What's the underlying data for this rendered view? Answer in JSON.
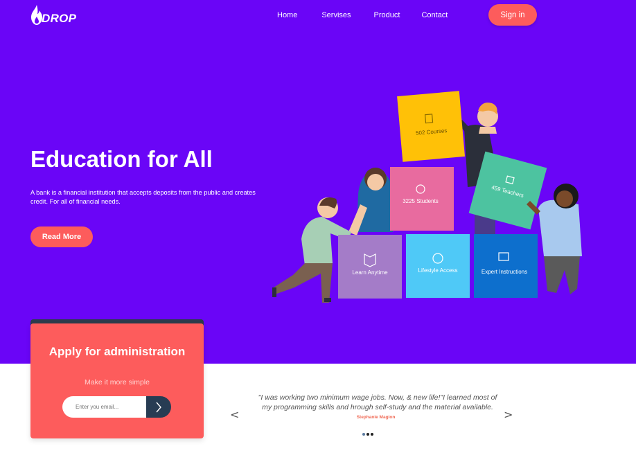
{
  "header": {
    "logo_text": "DROP",
    "logo_icon": "flame-icon",
    "nav": [
      "Home",
      "Servises",
      "Product",
      "Contact"
    ],
    "signin_label": "Sign in"
  },
  "hero": {
    "title": "Education for All",
    "description": "A bank is a financial institution that accepts deposits from the public and creates credit. For all of financial needs.",
    "read_more_label": "Read More",
    "background_color": "#6a05f7",
    "accent_color": "#fd5c5c"
  },
  "illustration": {
    "tiles": {
      "courses": "502 Courses",
      "students": "3225 Students",
      "teachers": "459 Teachers",
      "learn": "Learn Anytime",
      "lifestyle": "Lifestyle Access",
      "expert": "Expert Instructions"
    },
    "colors": {
      "courses": "#ffc107",
      "students": "#e86b9f",
      "teachers": "#4dc3a0",
      "learn": "#a47cc8",
      "lifestyle": "#4fc9f7",
      "expert": "#0d6fcd"
    }
  },
  "apply": {
    "title": "Apply for administration",
    "subtitle": "Make it more simple",
    "email_placeholder": "Enter you email..."
  },
  "testimonial": {
    "quote": "\"I was working two minimum wage jobs. Now, & new life!\"I learned most of my programming skills and hrough self-study and the material available.",
    "author": "Stephanie Magion",
    "prev_label": "<",
    "next_label": ">",
    "slide_count": 3,
    "active_slide": 1
  }
}
